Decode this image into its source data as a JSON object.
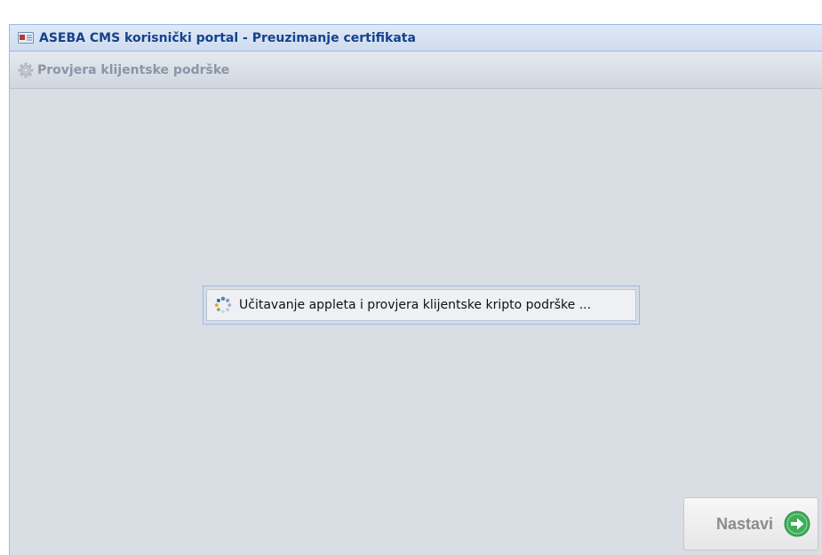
{
  "window": {
    "title": "ASEBA CMS korisnički portal - Preuzimanje certifikata",
    "title_icon": "window-card-icon"
  },
  "panel": {
    "title": "Provjera klijentske podrške",
    "icon": "gear-icon"
  },
  "loading": {
    "message": "Učitavanje appleta i provjera klijentske kripto podrške ...",
    "icon": "spinner-icon"
  },
  "footer": {
    "next_label": "Nastavi",
    "next_icon": "arrow-right-circle-icon"
  },
  "colors": {
    "title_text": "#15428b",
    "panel_text": "#8a96a6",
    "body_bg": "#d9dde4",
    "next_icon": "#3fae5a"
  }
}
